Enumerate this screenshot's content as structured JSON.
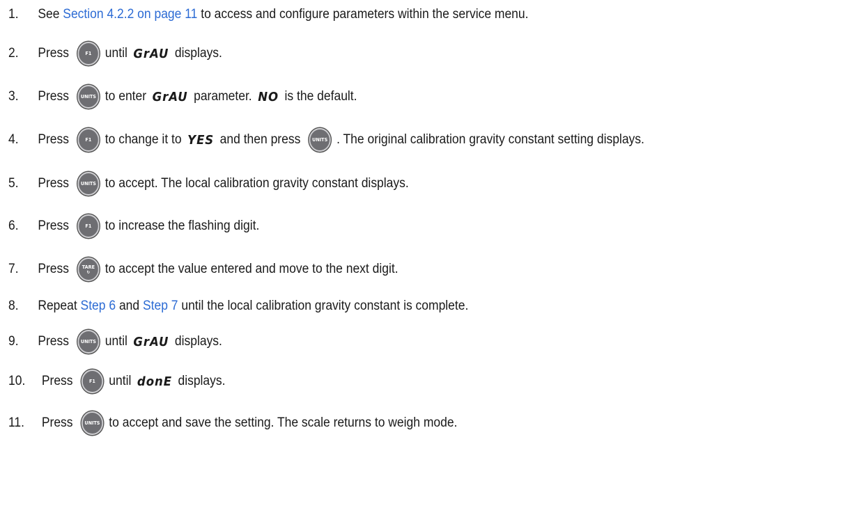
{
  "steps": [
    {
      "num": "1.",
      "parts": [
        {
          "t": "text",
          "v": "See "
        },
        {
          "t": "link",
          "v": "Section 4.2.2 on page 11"
        },
        {
          "t": "text",
          "v": " to access and configure parameters within the service menu."
        }
      ]
    },
    {
      "num": "2.",
      "parts": [
        {
          "t": "text",
          "v": "Press "
        },
        {
          "t": "key",
          "v": "F1",
          "icon": "f1-key-icon"
        },
        {
          "t": "text",
          "v": "until "
        },
        {
          "t": "seg",
          "v": "GrAU"
        },
        {
          "t": "text",
          "v": " displays."
        }
      ]
    },
    {
      "num": "3.",
      "parts": [
        {
          "t": "text",
          "v": "Press "
        },
        {
          "t": "key",
          "v": "UNITS",
          "icon": "units-key-icon"
        },
        {
          "t": "text",
          "v": "to enter "
        },
        {
          "t": "seg",
          "v": "GrAU"
        },
        {
          "t": "text",
          "v": " parameter. "
        },
        {
          "t": "seg",
          "v": "NO"
        },
        {
          "t": "text",
          "v": " is the default."
        }
      ]
    },
    {
      "num": "4.",
      "parts": [
        {
          "t": "text",
          "v": "Press "
        },
        {
          "t": "key",
          "v": "F1",
          "icon": "f1-key-icon"
        },
        {
          "t": "text",
          "v": "to change it to "
        },
        {
          "t": "seg",
          "v": "YES"
        },
        {
          "t": "text",
          "v": " and then press "
        },
        {
          "t": "key",
          "v": "UNITS",
          "icon": "units-key-icon"
        },
        {
          "t": "text",
          "v": ". The original calibration gravity constant setting displays."
        }
      ]
    },
    {
      "num": "5.",
      "parts": [
        {
          "t": "text",
          "v": "Press "
        },
        {
          "t": "key",
          "v": "UNITS",
          "icon": "units-key-icon"
        },
        {
          "t": "text",
          "v": "to accept. The local calibration gravity constant displays."
        }
      ]
    },
    {
      "num": "6.",
      "parts": [
        {
          "t": "text",
          "v": "Press "
        },
        {
          "t": "key",
          "v": "F1",
          "icon": "f1-key-icon"
        },
        {
          "t": "text",
          "v": "to increase the flashing digit."
        }
      ]
    },
    {
      "num": "7.",
      "parts": [
        {
          "t": "text",
          "v": "Press "
        },
        {
          "t": "key",
          "v": "TARE",
          "icon": "tare-key-icon"
        },
        {
          "t": "text",
          "v": "to accept the value entered and move to the next digit."
        }
      ]
    },
    {
      "num": "8.",
      "parts": [
        {
          "t": "text",
          "v": "Repeat "
        },
        {
          "t": "link",
          "v": "Step 6"
        },
        {
          "t": "text",
          "v": " and "
        },
        {
          "t": "link",
          "v": "Step 7"
        },
        {
          "t": "text",
          "v": " until the local calibration gravity constant is complete."
        }
      ]
    },
    {
      "num": "9.",
      "parts": [
        {
          "t": "text",
          "v": "Press "
        },
        {
          "t": "key",
          "v": "UNITS",
          "icon": "units-key-icon"
        },
        {
          "t": "text",
          "v": "until "
        },
        {
          "t": "seg",
          "v": "GrAU"
        },
        {
          "t": "text",
          "v": " displays."
        }
      ]
    },
    {
      "num": "10.",
      "parts": [
        {
          "t": "text",
          "v": "Press "
        },
        {
          "t": "key",
          "v": "F1",
          "icon": "f1-key-icon"
        },
        {
          "t": "text",
          "v": "until "
        },
        {
          "t": "seg",
          "v": "donE"
        },
        {
          "t": "text",
          "v": " displays."
        }
      ]
    },
    {
      "num": "11.",
      "parts": [
        {
          "t": "text",
          "v": "Press "
        },
        {
          "t": "key",
          "v": "UNITS",
          "icon": "units-key-icon"
        },
        {
          "t": "text",
          "v": "to accept and save the setting. The scale returns to weigh mode."
        }
      ]
    }
  ],
  "colors": {
    "link": "#2c6bd4",
    "key_fill": "#6e6e72",
    "text": "#1a1a1a"
  }
}
